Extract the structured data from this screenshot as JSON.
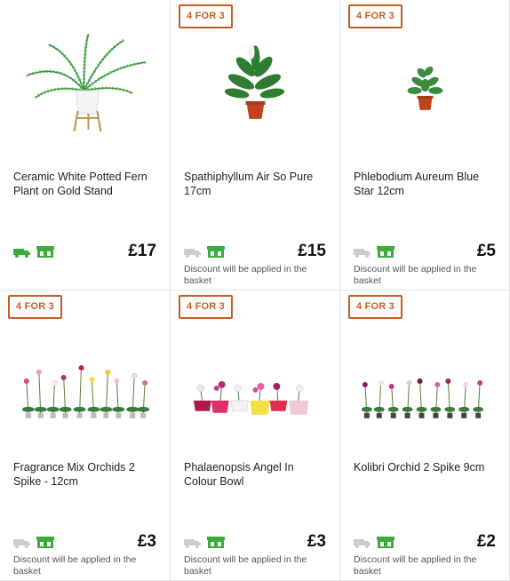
{
  "products": [
    {
      "name": "Ceramic White Potted Fern Plant on Gold Stand",
      "price": "£17",
      "badge": "",
      "discount_text": "",
      "delivery_active": true,
      "collect_active": true,
      "icons": [
        "fern-stand-image"
      ]
    },
    {
      "name": "Spathiphyllum Air So Pure 17cm",
      "price": "£15",
      "badge": "4 FOR 3",
      "discount_text": "Discount will be applied in the basket",
      "delivery_active": false,
      "collect_active": true
    },
    {
      "name": "Phlebodium Aureum Blue Star 12cm",
      "price": "£5",
      "badge": "4 FOR 3",
      "discount_text": "Discount will be applied in the basket",
      "delivery_active": false,
      "collect_active": true
    },
    {
      "name": "Fragrance Mix Orchids 2 Spike - 12cm",
      "price": "£3",
      "badge": "4 FOR 3",
      "discount_text": "Discount will be applied in the basket",
      "delivery_active": false,
      "collect_active": true
    },
    {
      "name": "Phalaenopsis Angel In Colour Bowl",
      "price": "£3",
      "badge": "4 FOR 3",
      "discount_text": "Discount will be applied in the basket",
      "delivery_active": false,
      "collect_active": true
    },
    {
      "name": "Kolibri Orchid 2 Spike 9cm",
      "price": "£2",
      "badge": "4 FOR 3",
      "discount_text": "Discount will be applied in the basket",
      "delivery_active": false,
      "collect_active": true
    }
  ],
  "colors": {
    "badge": "#c65d1e",
    "active_icon": "#3daa3d",
    "inactive_icon": "#cccccc"
  },
  "icon_names": [
    "delivery-truck-icon",
    "click-and-collect-store-icon"
  ]
}
